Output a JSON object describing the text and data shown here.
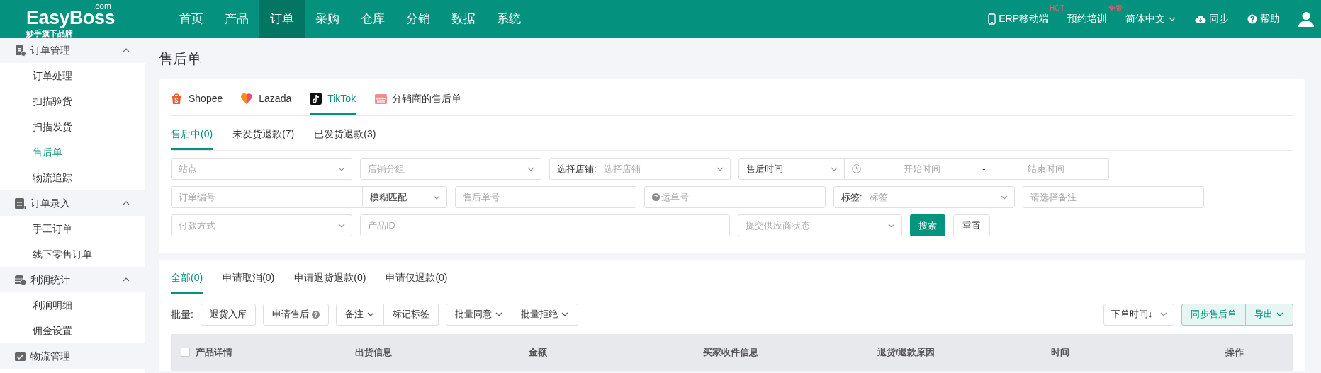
{
  "header": {
    "logo": "EasyBoss",
    "logo_suffix": ".com",
    "tagline": "妙手旗下品牌",
    "nav": [
      {
        "label": "首页",
        "selected": false
      },
      {
        "label": "产品",
        "selected": false
      },
      {
        "label": "订单",
        "selected": true
      },
      {
        "label": "采购",
        "selected": false
      },
      {
        "label": "仓库",
        "selected": false
      },
      {
        "label": "分销",
        "selected": false
      },
      {
        "label": "数据",
        "selected": false
      },
      {
        "label": "系统",
        "selected": false
      }
    ],
    "links": [
      {
        "kind": "mobile",
        "label": "ERP移动端",
        "badge": "HOT"
      },
      {
        "kind": "plain",
        "label": "预约培训",
        "badge": "免费"
      },
      {
        "kind": "language",
        "label": "简体中文"
      },
      {
        "kind": "sync",
        "label": "同步"
      },
      {
        "kind": "help",
        "label": "帮助"
      }
    ]
  },
  "sidebar": {
    "groups": [
      {
        "label": "订单管理",
        "expanded": true,
        "items": [
          {
            "label": "订单处理",
            "selected": false
          },
          {
            "label": "扫描验货",
            "selected": false
          },
          {
            "label": "扫描发货",
            "selected": false
          },
          {
            "label": "售后单",
            "selected": true
          },
          {
            "label": "物流追踪",
            "selected": false
          }
        ]
      },
      {
        "label": "订单录入",
        "expanded": true,
        "items": [
          {
            "label": "手工订单",
            "selected": false
          },
          {
            "label": "线下零售订单",
            "selected": false
          }
        ]
      },
      {
        "label": "利润统计",
        "expanded": true,
        "items": [
          {
            "label": "利润明细",
            "selected": false
          },
          {
            "label": "佣金设置",
            "selected": false
          }
        ]
      },
      {
        "label": "物流管理"
      }
    ]
  },
  "page_title": "售后单",
  "platform_tabs": [
    {
      "kind": "shopee",
      "label": "Shopee",
      "selected": false
    },
    {
      "kind": "lazada",
      "label": "Lazada",
      "selected": false
    },
    {
      "kind": "tiktok",
      "label": "TikTok",
      "selected": true
    },
    {
      "kind": "distributor",
      "label": "分销商的售后单",
      "selected": false
    }
  ],
  "status_tabs": [
    {
      "label": "售后中(0)",
      "selected": true
    },
    {
      "label": "未发货退款(7)",
      "selected": false
    },
    {
      "label": "已发货退款(3)",
      "selected": false
    }
  ],
  "filters": [
    [
      {
        "kind": "select",
        "placeholder": "站点"
      },
      {
        "kind": "select",
        "placeholder": "店铺分组"
      },
      {
        "kind": "labeled-select",
        "label": "选择店铺:",
        "placeholder": "选择店铺"
      },
      {
        "kind": "time-select",
        "value": "售后时间"
      },
      {
        "kind": "date-range",
        "start": "开始时间",
        "separator": "-",
        "end": "结束时间"
      }
    ],
    [
      {
        "kind": "match-input",
        "placeholder": "订单编号",
        "value": "模糊匹配"
      },
      {
        "kind": "input",
        "placeholder": "售后单号"
      },
      {
        "kind": "help-input",
        "placeholder": "运单号"
      },
      {
        "kind": "labeled-select",
        "label": "标签:",
        "placeholder": "标签"
      },
      {
        "kind": "input",
        "placeholder": "请选择备注"
      }
    ],
    [
      {
        "kind": "select",
        "placeholder": "付款方式"
      },
      {
        "kind": "wide-input",
        "placeholder": "产品ID"
      },
      {
        "kind": "narrow-select",
        "placeholder": "提交供应商状态"
      },
      {
        "kind": "primary-button",
        "label": "搜索"
      },
      {
        "kind": "button",
        "label": "重置"
      }
    ]
  ],
  "list_tabs": [
    {
      "label": "全部(0)",
      "selected": true
    },
    {
      "label": "申请取消(0)",
      "selected": false
    },
    {
      "label": "申请退货退款(0)",
      "selected": false
    },
    {
      "label": "申请仅退款(0)",
      "selected": false
    }
  ],
  "toolbar": {
    "label": "批量:",
    "groups": [
      [
        {
          "label": "退货入库"
        }
      ],
      [
        {
          "label": "申请售后",
          "help": true
        }
      ],
      [
        {
          "label": "备注",
          "dropdown": true
        },
        {
          "label": "标记标签"
        }
      ],
      [
        {
          "label": "批量同意",
          "dropdown": true
        },
        {
          "label": "批量拒绝",
          "dropdown": true
        }
      ]
    ],
    "sort": "下单时间↓",
    "actions": [
      {
        "label": "同步售后单"
      },
      {
        "label": "导出",
        "dropdown": true
      }
    ]
  },
  "table": {
    "select_all": {
      "checked": false
    },
    "columns": [
      "产品详情",
      "出货信息",
      "金额",
      "买家收件信息",
      "退货/退款原因",
      "时间",
      "操作"
    ]
  }
}
